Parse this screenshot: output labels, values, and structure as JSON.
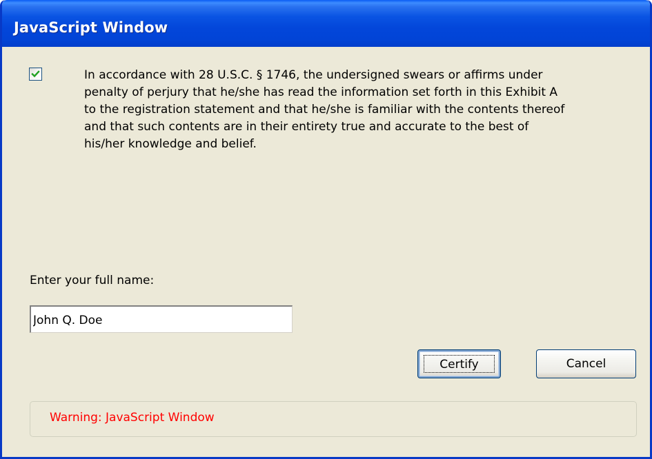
{
  "window": {
    "title": "JavaScript Window"
  },
  "certification": {
    "checked": true,
    "statement_lines": [
      "In accordance with 28 U.S.C. § 1746, the undersigned swears or affirms under",
      "penalty of perjury that he/she has read the information set forth in this Exhibit A",
      "to the registration statement and that he/she is familiar with the contents thereof",
      "and that such contents are in their entirety true and accurate to the best of",
      "his/her knowledge and belief."
    ]
  },
  "name_field": {
    "label": "Enter your full name:",
    "value": "John Q. Doe"
  },
  "buttons": {
    "certify": "Certify",
    "cancel": "Cancel"
  },
  "warning": {
    "text": "Warning: JavaScript Window",
    "color": "#FF0000"
  },
  "colors": {
    "titlebar": "#0244D6",
    "window_background": "#ECE9D8",
    "checkmark": "#21A121"
  }
}
